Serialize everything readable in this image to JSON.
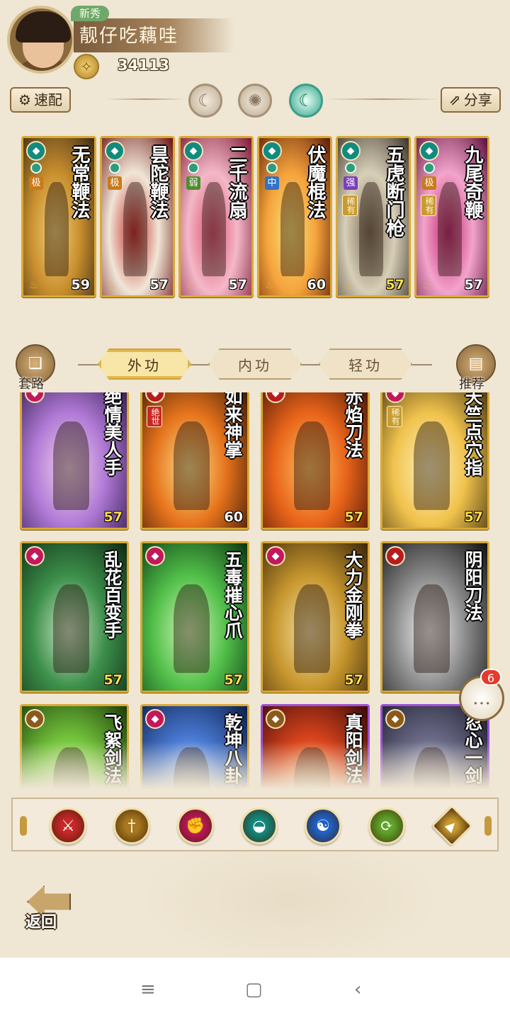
{
  "player": {
    "rookie_tag": "新秀",
    "name": "靓仔吃藕哇",
    "power": "34113"
  },
  "toolbar": {
    "quick_match": "速配",
    "share": "分享"
  },
  "equipped": [
    {
      "title": "无常鞭法",
      "level": "59",
      "tag": "极",
      "tag_color": "#c97a1c",
      "gradient": [
        "#3b2a14",
        "#c98f2e",
        "#f3d27a"
      ]
    },
    {
      "title": "昙陀鞭法",
      "level": "57",
      "tag": "极",
      "tag_color": "#c97a1c",
      "gradient": [
        "#6a1010",
        "#f0e6d6",
        "#c62828"
      ]
    },
    {
      "title": "二千流扇",
      "level": "57",
      "tag": "弱",
      "tag_color": "#4e8d2c",
      "gradient": [
        "#7a1832",
        "#f4b8c8",
        "#d94f6e"
      ]
    },
    {
      "title": "伏魔棍法",
      "level": "60",
      "tag": "中",
      "tag_color": "#2f72c6",
      "gradient": [
        "#5a1a08",
        "#f5a33c",
        "#fbe37a"
      ]
    },
    {
      "title": "五虎断门枪",
      "level": "57",
      "tag": "强",
      "tag_color": "#7b3fb8",
      "rare": "稀有",
      "gold": true,
      "gradient": [
        "#3a3228",
        "#d8cfb8",
        "#7a6a52"
      ]
    },
    {
      "title": "九尾奇鞭",
      "level": "57",
      "tag": "极",
      "tag_color": "#c97a1c",
      "rare": "稀有",
      "gradient": [
        "#5a0e3a",
        "#f3a4cc",
        "#c0246c"
      ]
    }
  ],
  "tabs": {
    "outer": "外功",
    "inner": "内功",
    "light": "轻功"
  },
  "side": {
    "routine": "套路",
    "recommend": "推荐"
  },
  "skills": [
    {
      "title": "绝情美人手",
      "level": "57",
      "gradient": [
        "#2b1446",
        "#b07ad6",
        "#f4d3ea"
      ],
      "school_color": "#c2185b",
      "gold": true
    },
    {
      "title": "如来神掌",
      "level": "60",
      "gradient": [
        "#2a0e04",
        "#e5731c",
        "#ffe08a"
      ],
      "school_color": "#b71c1c",
      "badge": "绝世"
    },
    {
      "title": "赤焰刀法",
      "level": "57",
      "gradient": [
        "#3a0e02",
        "#e8641a",
        "#ffc061"
      ],
      "school_color": "#b71c1c",
      "gold": true
    },
    {
      "title": "天竺点穴指",
      "level": "57",
      "gradient": [
        "#3a2a0a",
        "#f0c24c",
        "#fff3c0"
      ],
      "school_color": "#c2185b",
      "rare": "稀有",
      "gold": true
    },
    {
      "title": "乱花百变手",
      "level": "57",
      "gradient": [
        "#0e2a14",
        "#3c8f4a",
        "#cfe8c9"
      ],
      "school_color": "#c2185b",
      "gold": true
    },
    {
      "title": "五毒摧心爪",
      "level": "57",
      "gradient": [
        "#0a3410",
        "#52c04a",
        "#d6f5b8"
      ],
      "school_color": "#c2185b",
      "gold": true
    },
    {
      "title": "大力金刚拳",
      "level": "57",
      "gradient": [
        "#3a2608",
        "#c7962e",
        "#f6e2a4"
      ],
      "school_color": "#c2185b",
      "gold": true
    },
    {
      "title": "阴阳刀法",
      "level": "",
      "gradient": [
        "#101010",
        "#8a8a8a",
        "#f4f4f4"
      ],
      "school_color": "#b71c1c"
    },
    {
      "title": "飞絮剑法",
      "level": "",
      "gradient": [
        "#1a3a08",
        "#74c43c",
        "#e8f7c4"
      ],
      "school_color": "#8b5a1a"
    },
    {
      "title": "乾坤八卦",
      "level": "",
      "gradient": [
        "#0a1e4a",
        "#4a7ad4",
        "#e4eef9"
      ],
      "school_color": "#c2185b"
    },
    {
      "title": "真阳剑法",
      "level": "",
      "gradient": [
        "#3a0808",
        "#d8441c",
        "#ffd28a"
      ],
      "school_color": "#8b5a1a",
      "purple": true
    },
    {
      "title": "忍心一剑",
      "level": "",
      "gradient": [
        "#1a1a28",
        "#6a6a88",
        "#e8e4f0"
      ],
      "school_color": "#8b5a1a",
      "purple": true
    }
  ],
  "schools": [
    {
      "name": "blade-icon",
      "color": "#c62828",
      "glyph": "⚔"
    },
    {
      "name": "sword-icon",
      "color": "#a6781f",
      "glyph": "†"
    },
    {
      "name": "fist-icon",
      "color": "#c2185b",
      "glyph": "✊"
    },
    {
      "name": "fan-icon",
      "color": "#138a7e",
      "glyph": "◒"
    },
    {
      "name": "taiji-icon",
      "color": "#1f62c6",
      "glyph": "☯"
    },
    {
      "name": "whip-icon",
      "color": "#5fa32a",
      "glyph": "⟳"
    },
    {
      "name": "special-icon",
      "color": "#c79b2f",
      "glyph": "▲"
    }
  ],
  "back": {
    "label": "返回"
  },
  "chat": {
    "count": "6"
  }
}
